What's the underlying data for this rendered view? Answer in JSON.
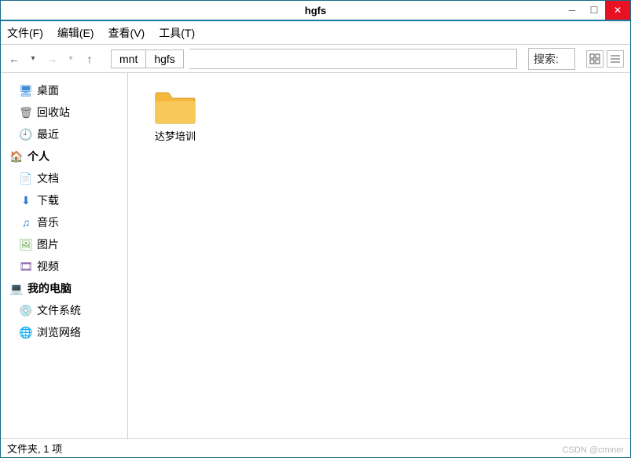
{
  "window": {
    "title": "hgfs"
  },
  "menubar": {
    "file": "文件(F)",
    "edit": "编辑(E)",
    "view": "查看(V)",
    "tools": "工具(T)"
  },
  "nav": {
    "back": "←",
    "back_menu": "▾",
    "forward": "→",
    "forward_menu": "▾",
    "up": "↑"
  },
  "breadcrumb": [
    "mnt",
    "hgfs"
  ],
  "search": {
    "label": "搜索:"
  },
  "sidebar": {
    "items": [
      {
        "label": "桌面",
        "icon": "🖥",
        "color": "#3b8dd6"
      },
      {
        "label": "回收站",
        "icon": "🗑",
        "color": "#666"
      },
      {
        "label": "最近",
        "icon": "🕘",
        "color": "#c47"
      },
      {
        "label": "个人",
        "icon": "🏠",
        "color": "#e08b1a",
        "header": true
      },
      {
        "label": "文档",
        "icon": "📄",
        "color": "#888"
      },
      {
        "label": "下载",
        "icon": "⬇",
        "color": "#2a7ad4"
      },
      {
        "label": "音乐",
        "icon": "♫",
        "color": "#2a7ad4"
      },
      {
        "label": "图片",
        "icon": "🖼",
        "color": "#6aa84f"
      },
      {
        "label": "视频",
        "icon": "🎞",
        "color": "#7b4fa0"
      },
      {
        "label": "我的电脑",
        "icon": "💻",
        "color": "#2a7ad4",
        "header": true
      },
      {
        "label": "文件系统",
        "icon": "💿",
        "color": "#2a7ad4"
      },
      {
        "label": "浏览网络",
        "icon": "🌐",
        "color": "#2a9d5a"
      }
    ]
  },
  "main": {
    "items": [
      {
        "label": "达梦培训",
        "type": "folder"
      }
    ]
  },
  "statusbar": {
    "text": "文件夹, 1 项"
  },
  "watermark": "CSDN @cminer"
}
